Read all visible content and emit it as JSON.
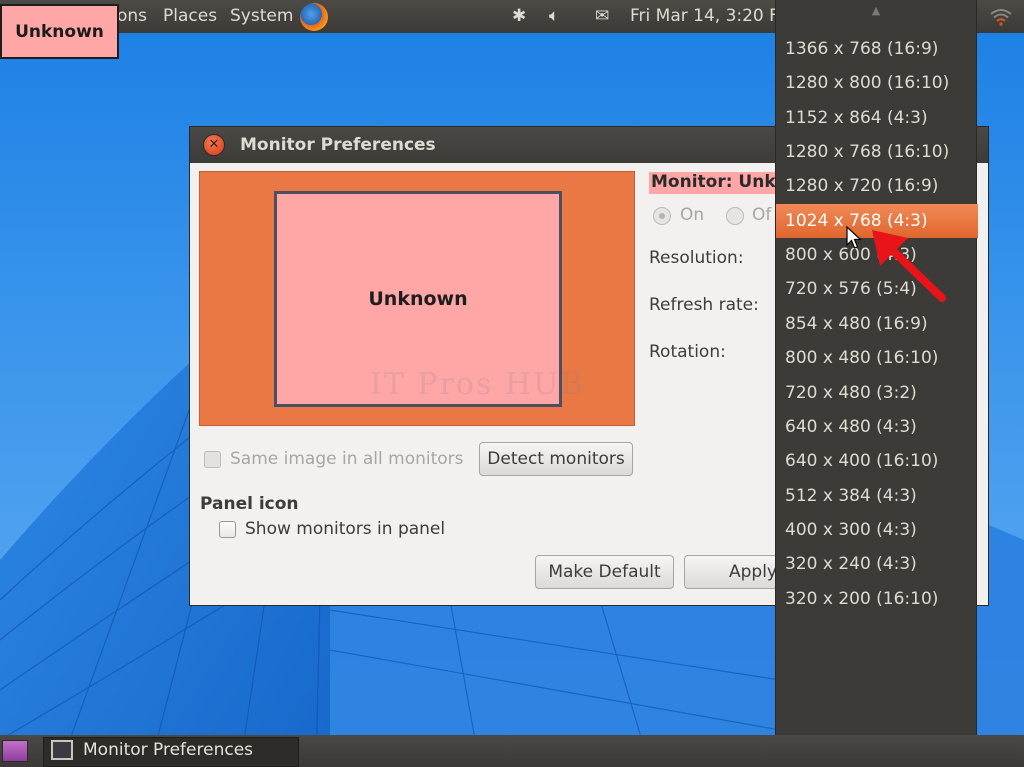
{
  "desktop": {
    "badge_label": "Unknown"
  },
  "top_panel": {
    "menus": [
      {
        "label": "ons"
      },
      {
        "label": "Places"
      },
      {
        "label": "System"
      }
    ],
    "clock": "Fri Mar 14,  3:20 F",
    "tray_icons": [
      "bluetooth-icon",
      "volume-icon",
      "mail-icon",
      "wifi-icon"
    ]
  },
  "dialog": {
    "title": "Monitor Preferences",
    "monitor_preview_label": "Unknown",
    "watermark": "IT Pros HUB",
    "same_image_label": "Same image in all monitors",
    "detect_button": "Detect monitors",
    "panel_icon_heading": "Panel icon",
    "show_monitors_label": "Show monitors in panel",
    "make_default_button": "Make Default",
    "apply_button": "Apply",
    "monitor_header": "Monitor: Unkn",
    "on_label": "On",
    "off_label": "Of",
    "resolution_label": "Resolution:",
    "refresh_label": "Refresh rate:",
    "rotation_label": "Rotation:"
  },
  "dropdown": {
    "selected": "1024 x 768 (4:3)",
    "items": [
      "1366 x 768 (16:9)",
      "1280 x 800 (16:10)",
      "1152 x 864 (4:3)",
      "1280 x 768 (16:10)",
      "1280 x 720 (16:9)",
      "1024 x 768 (4:3)",
      "800 x 600 (4:3)",
      "720 x 576 (5:4)",
      "854 x 480 (16:9)",
      "800 x 480 (16:10)",
      "720 x 480 (3:2)",
      "640 x 480 (4:3)",
      "640 x 400 (16:10)",
      "512 x 384 (4:3)",
      "400 x 300 (4:3)",
      "320 x 240 (4:3)",
      "320 x 200 (16:10)"
    ]
  },
  "taskbar": {
    "window_label": "Monitor Preferences"
  },
  "colors": {
    "accent_orange": "#e0662d",
    "monitor_pink": "#ffa6a6",
    "panel_dark": "#3c3b37",
    "annotation_red": "#e8141a"
  }
}
